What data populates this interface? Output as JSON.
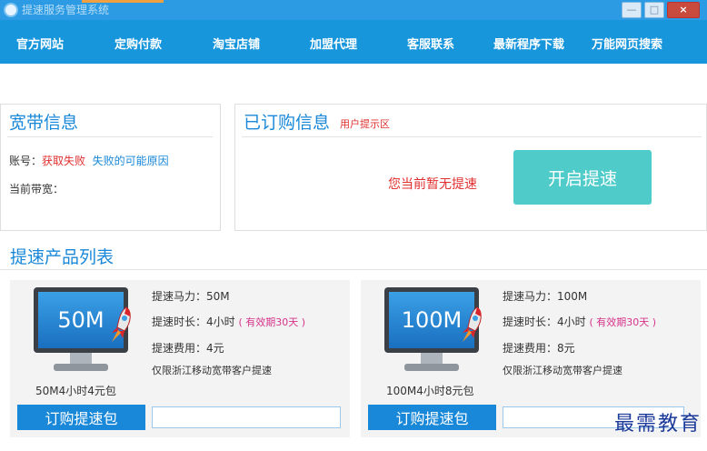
{
  "window": {
    "title": "提速服务管理系统",
    "minimize_symbol": "—",
    "maximize_symbol": "□",
    "close_symbol": "×"
  },
  "nav": {
    "items": [
      "官方网站",
      "定购付款",
      "淘宝店铺",
      "加盟代理",
      "客服联系",
      "最新程序下载",
      "万能网页搜索"
    ]
  },
  "broadband": {
    "title": "宽带信息",
    "account_label": "账号：",
    "account_status": "获取失败",
    "failure_link": "失败的可能原因",
    "bandwidth_label": "当前带宽："
  },
  "subscribed": {
    "title": "已订购信息",
    "hint": "用户提示区",
    "message": "您当前暂无提速",
    "start_button": "开启提速"
  },
  "products": {
    "title": "提速产品列表",
    "items": [
      {
        "screen_text": "50M",
        "caption": "50M4小时4元包",
        "power": "提速马力：50M",
        "duration": "提速时长：4小时",
        "validity": "( 有效期30天 )",
        "fee": "提速费用：4元",
        "restriction": "仅限浙江移动宽带客户提速",
        "buy_label": "订购提速包"
      },
      {
        "screen_text": "100M",
        "caption": "100M4小时8元包",
        "power": "提速马力：100M",
        "duration": "提速时长：4小时",
        "validity": "( 有效期30天 )",
        "fee": "提速费用：8元",
        "restriction": "仅限浙江移动宽带客户提速",
        "buy_label": "订购提速包"
      }
    ]
  },
  "watermark": "最需教育",
  "colors": {
    "nav_bg": "#1896dc",
    "accent_blue": "#1a88d8",
    "start_button": "#4fcbc9",
    "alert_red": "#e03030"
  }
}
